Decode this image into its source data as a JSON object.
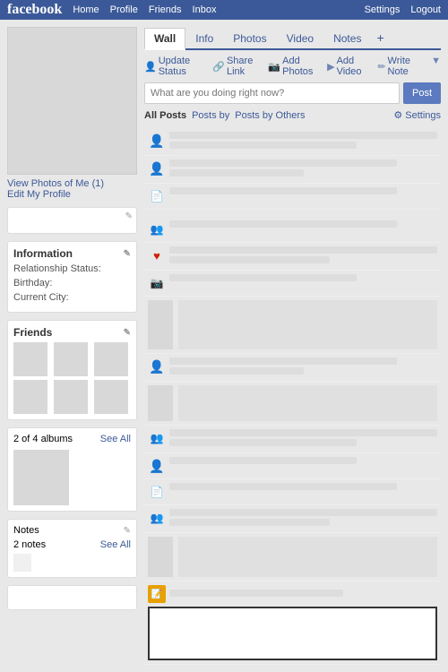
{
  "header": {
    "logo": "facebook",
    "nav": [
      "Home",
      "Profile",
      "Friends",
      "Inbox"
    ],
    "right_nav": [
      "Settings",
      "Logout"
    ]
  },
  "tabs": [
    "Wall",
    "Info",
    "Photos",
    "Video",
    "Notes",
    "+"
  ],
  "active_tab": "Wall",
  "actions": [
    {
      "label": "Update Status",
      "icon": "person-icon"
    },
    {
      "label": "Share Link",
      "icon": "link-icon"
    },
    {
      "label": "Add Photos",
      "icon": "photo-icon"
    },
    {
      "label": "Add Video",
      "icon": "video-icon"
    },
    {
      "label": "Write Note",
      "icon": "note-icon"
    }
  ],
  "status_input": {
    "placeholder": "What are you doing right now?",
    "post_button": "Post"
  },
  "filter": {
    "all_posts": "All Posts",
    "posts_by": "Posts by",
    "posts_by_others": "Posts by Others",
    "settings": "⚙ Settings"
  },
  "sidebar": {
    "view_photos": "View Photos of Me (1)",
    "edit_profile": "Edit My Profile",
    "information": "Information",
    "info_fields": [
      {
        "label": "Relationship Status:"
      },
      {
        "label": "Birthday:"
      },
      {
        "label": "Current City:"
      }
    ],
    "friends": "Friends",
    "albums": {
      "label": "2 of 4 albums",
      "see_all": "See All"
    },
    "notes": {
      "label": "Notes",
      "count": "2 notes",
      "see_all": "See All"
    }
  }
}
